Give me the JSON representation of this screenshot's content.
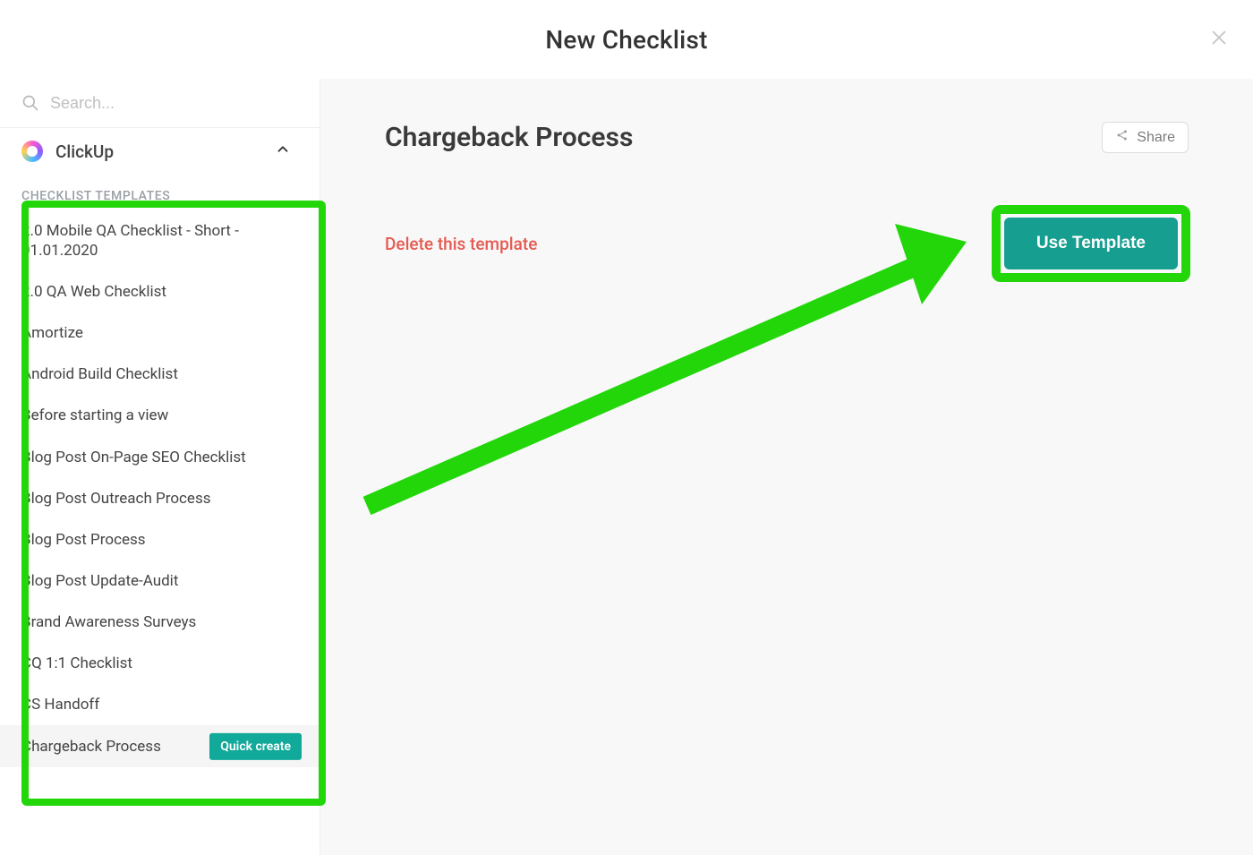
{
  "header": {
    "title": "New Checklist"
  },
  "sidebar": {
    "search_placeholder": "Search...",
    "workspace_name": "ClickUp",
    "section_label": "CHECKLIST TEMPLATES",
    "selected_quick_create_label": "Quick create",
    "items": [
      {
        "label": "2.0 Mobile QA Checklist - Short - 01.01.2020",
        "selected": false
      },
      {
        "label": "2.0 QA Web Checklist",
        "selected": false
      },
      {
        "label": "Amortize",
        "selected": false
      },
      {
        "label": "Android Build Checklist",
        "selected": false
      },
      {
        "label": "Before starting a view",
        "selected": false
      },
      {
        "label": "Blog Post On-Page SEO Checklist",
        "selected": false
      },
      {
        "label": "Blog Post Outreach Process",
        "selected": false
      },
      {
        "label": "Blog Post Process",
        "selected": false
      },
      {
        "label": "Blog Post Update-Audit",
        "selected": false
      },
      {
        "label": "Brand Awareness Surveys",
        "selected": false
      },
      {
        "label": "CQ 1:1 Checklist",
        "selected": false
      },
      {
        "label": "CS Handoff",
        "selected": false
      },
      {
        "label": "Chargeback Process",
        "selected": true
      }
    ]
  },
  "main": {
    "title": "Chargeback Process",
    "share_label": "Share",
    "delete_label": "Delete this template",
    "use_template_label": "Use Template"
  },
  "annotation": {
    "color": "#22d60a"
  }
}
